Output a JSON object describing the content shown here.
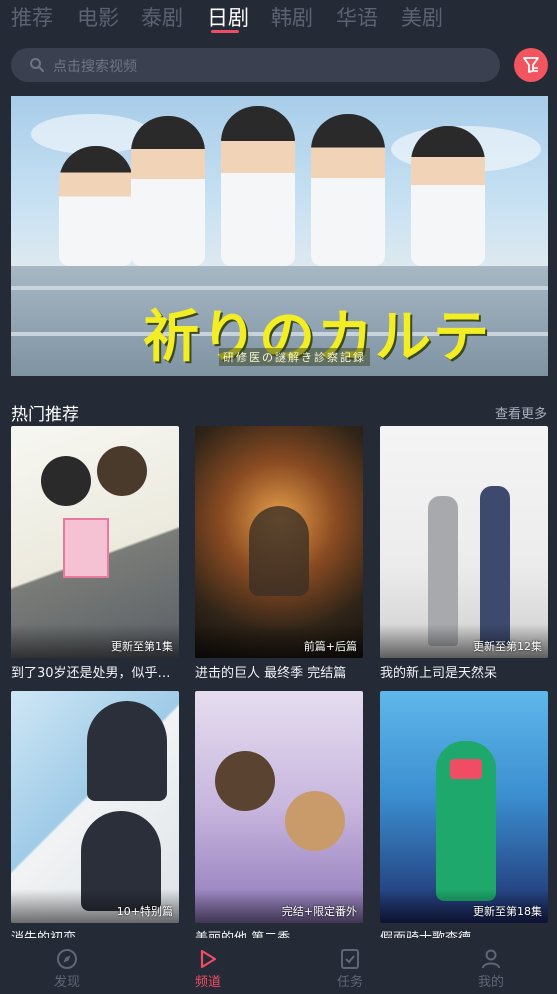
{
  "tabs": [
    {
      "label": "推荐",
      "active": false
    },
    {
      "label": "电影",
      "active": false
    },
    {
      "label": "泰剧",
      "active": false
    },
    {
      "label": "日剧",
      "active": true
    },
    {
      "label": "韩剧",
      "active": false
    },
    {
      "label": "华语",
      "active": false
    },
    {
      "label": "美剧",
      "active": false
    }
  ],
  "search": {
    "placeholder": "点击搜索视频",
    "search_icon": "search-icon",
    "filter_icon": "filter-icon"
  },
  "banner": {
    "title": "祈りのカルテ",
    "subtitle": "研修医の謎解き診察記録"
  },
  "section": {
    "title": "热门推荐",
    "more_label": "查看更多"
  },
  "cards": [
    {
      "title": "到了30岁还是处男，似乎…",
      "badge": "更新至第1集"
    },
    {
      "title": "进击的巨人 最终季 完结篇",
      "badge": "前篇+后篇"
    },
    {
      "title": "我的新上司是天然呆",
      "badge": "更新至第12集"
    },
    {
      "title": "消失的初恋",
      "badge": "10+特别篇"
    },
    {
      "title": "美丽的他 第二季",
      "badge": "完结+限定番外"
    },
    {
      "title": "假面骑士歌查德",
      "badge": "更新至第18集"
    }
  ],
  "bottom_nav": [
    {
      "label": "发现",
      "icon": "compass-icon",
      "active": false
    },
    {
      "label": "频道",
      "icon": "play-channel-icon",
      "active": true
    },
    {
      "label": "任务",
      "icon": "task-check-icon",
      "active": false
    },
    {
      "label": "我的",
      "icon": "user-icon",
      "active": false
    }
  ],
  "colors": {
    "background": "#252a37",
    "accent": "#f04d64",
    "filter_button": "#f35560"
  }
}
